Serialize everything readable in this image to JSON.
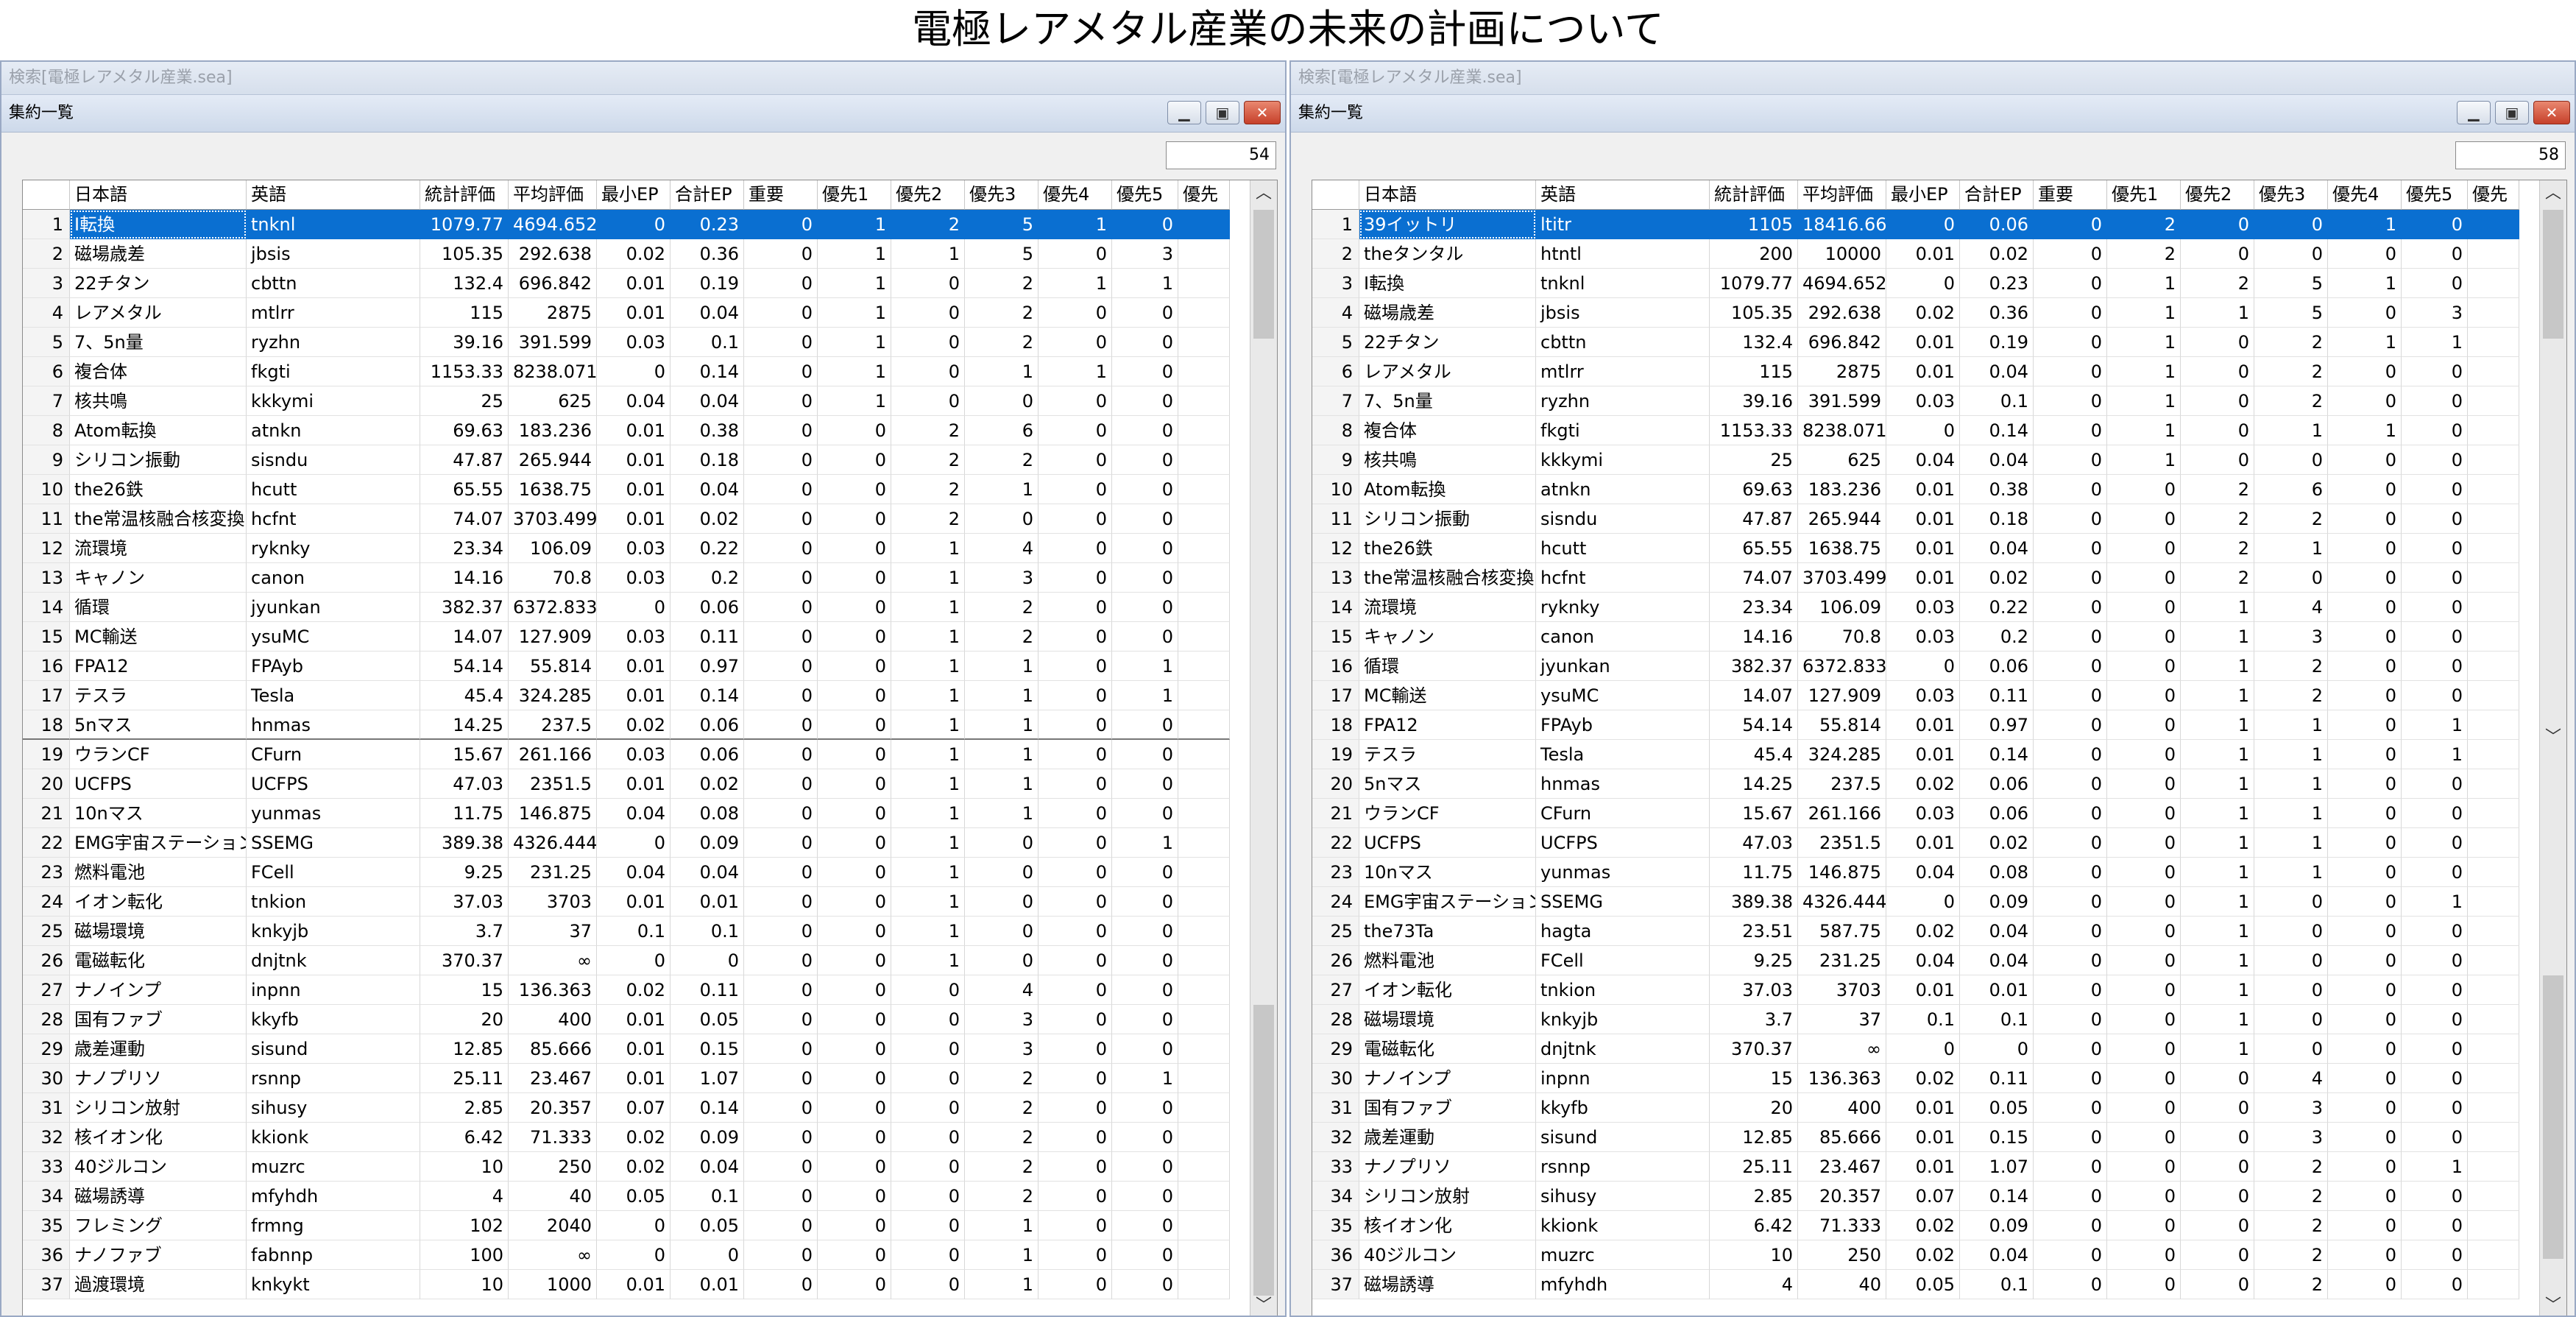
{
  "page_title": "電極レアメタル産業の未来の計画について",
  "icons": {
    "minimize": "minimize-icon",
    "restore": "restore-icon",
    "close": "close-icon",
    "scroll_up": "chevron-up-icon",
    "scroll_down": "chevron-down-icon"
  },
  "columns": [
    "日本語",
    "英語",
    "統計評価",
    "平均評価",
    "最小EP",
    "合計EP",
    "重要",
    "優先1",
    "優先2",
    "優先3",
    "優先4",
    "優先5",
    "優先"
  ],
  "left": {
    "outer_title": "検索[電極レアメタル産業.sea]",
    "inner_title": "集約一覧",
    "count": "54",
    "selected_row": 0,
    "separator_after_row": 17,
    "rows": [
      [
        "1",
        "I転換",
        "tnknl",
        "1079.77",
        "4694.652",
        "0",
        "0.23",
        "0",
        "1",
        "2",
        "5",
        "1",
        "0"
      ],
      [
        "2",
        "磁場歳差",
        "jbsis",
        "105.35",
        "292.638",
        "0.02",
        "0.36",
        "0",
        "1",
        "1",
        "5",
        "0",
        "3"
      ],
      [
        "3",
        "22チタン",
        "cbttn",
        "132.4",
        "696.842",
        "0.01",
        "0.19",
        "0",
        "1",
        "0",
        "2",
        "1",
        "1"
      ],
      [
        "4",
        "レアメタル",
        "mtlrr",
        "115",
        "2875",
        "0.01",
        "0.04",
        "0",
        "1",
        "0",
        "2",
        "0",
        "0"
      ],
      [
        "5",
        "7、5n量",
        "ryzhn",
        "39.16",
        "391.599",
        "0.03",
        "0.1",
        "0",
        "1",
        "0",
        "2",
        "0",
        "0"
      ],
      [
        "6",
        "複合体",
        "fkgti",
        "1153.33",
        "8238.071",
        "0",
        "0.14",
        "0",
        "1",
        "0",
        "1",
        "1",
        "0"
      ],
      [
        "7",
        "核共鳴",
        "kkkymi",
        "25",
        "625",
        "0.04",
        "0.04",
        "0",
        "1",
        "0",
        "0",
        "0",
        "0"
      ],
      [
        "8",
        "Atom転換",
        "atnkn",
        "69.63",
        "183.236",
        "0.01",
        "0.38",
        "0",
        "0",
        "2",
        "6",
        "0",
        "0"
      ],
      [
        "9",
        "シリコン振動",
        "sisndu",
        "47.87",
        "265.944",
        "0.01",
        "0.18",
        "0",
        "0",
        "2",
        "2",
        "0",
        "0"
      ],
      [
        "10",
        "the26鉄",
        "hcutt",
        "65.55",
        "1638.75",
        "0.01",
        "0.04",
        "0",
        "0",
        "2",
        "1",
        "0",
        "0"
      ],
      [
        "11",
        "the常温核融合核変換",
        "hcfnt",
        "74.07",
        "3703.499",
        "0.01",
        "0.02",
        "0",
        "0",
        "2",
        "0",
        "0",
        "0"
      ],
      [
        "12",
        "流環境",
        "ryknky",
        "23.34",
        "106.09",
        "0.03",
        "0.22",
        "0",
        "0",
        "1",
        "4",
        "0",
        "0"
      ],
      [
        "13",
        "キャノン",
        "canon",
        "14.16",
        "70.8",
        "0.03",
        "0.2",
        "0",
        "0",
        "1",
        "3",
        "0",
        "0"
      ],
      [
        "14",
        "循環",
        "jyunkan",
        "382.37",
        "6372.833",
        "0",
        "0.06",
        "0",
        "0",
        "1",
        "2",
        "0",
        "0"
      ],
      [
        "15",
        "MC輸送",
        "ysuMC",
        "14.07",
        "127.909",
        "0.03",
        "0.11",
        "0",
        "0",
        "1",
        "2",
        "0",
        "0"
      ],
      [
        "16",
        "FPA12",
        "FPAyb",
        "54.14",
        "55.814",
        "0.01",
        "0.97",
        "0",
        "0",
        "1",
        "1",
        "0",
        "1"
      ],
      [
        "17",
        "テスラ",
        "Tesla",
        "45.4",
        "324.285",
        "0.01",
        "0.14",
        "0",
        "0",
        "1",
        "1",
        "0",
        "1"
      ],
      [
        "18",
        "5nマス",
        "hnmas",
        "14.25",
        "237.5",
        "0.02",
        "0.06",
        "0",
        "0",
        "1",
        "1",
        "0",
        "0"
      ],
      [
        "19",
        "ウランCF",
        "CFurn",
        "15.67",
        "261.166",
        "0.03",
        "0.06",
        "0",
        "0",
        "1",
        "1",
        "0",
        "0"
      ],
      [
        "20",
        "UCFPS",
        "UCFPS",
        "47.03",
        "2351.5",
        "0.01",
        "0.02",
        "0",
        "0",
        "1",
        "1",
        "0",
        "0"
      ],
      [
        "21",
        "10nマス",
        "yunmas",
        "11.75",
        "146.875",
        "0.04",
        "0.08",
        "0",
        "0",
        "1",
        "1",
        "0",
        "0"
      ],
      [
        "22",
        "EMG宇宙ステーション",
        "SSEMG",
        "389.38",
        "4326.444",
        "0",
        "0.09",
        "0",
        "0",
        "1",
        "0",
        "0",
        "1"
      ],
      [
        "23",
        "燃料電池",
        "FCell",
        "9.25",
        "231.25",
        "0.04",
        "0.04",
        "0",
        "0",
        "1",
        "0",
        "0",
        "0"
      ],
      [
        "24",
        "イオン転化",
        "tnkion",
        "37.03",
        "3703",
        "0.01",
        "0.01",
        "0",
        "0",
        "1",
        "0",
        "0",
        "0"
      ],
      [
        "25",
        "磁場環境",
        "knkyjb",
        "3.7",
        "37",
        "0.1",
        "0.1",
        "0",
        "0",
        "1",
        "0",
        "0",
        "0"
      ],
      [
        "26",
        "電磁転化",
        "dnjtnk",
        "370.37",
        "∞",
        "0",
        "0",
        "0",
        "0",
        "1",
        "0",
        "0",
        "0"
      ],
      [
        "27",
        "ナノインプ",
        "inpnn",
        "15",
        "136.363",
        "0.02",
        "0.11",
        "0",
        "0",
        "0",
        "4",
        "0",
        "0"
      ],
      [
        "28",
        "国有ファブ",
        "kkyfb",
        "20",
        "400",
        "0.01",
        "0.05",
        "0",
        "0",
        "0",
        "3",
        "0",
        "0"
      ],
      [
        "29",
        "歳差運動",
        "sisund",
        "12.85",
        "85.666",
        "0.01",
        "0.15",
        "0",
        "0",
        "0",
        "3",
        "0",
        "0"
      ],
      [
        "30",
        "ナノプリソ",
        "rsnnp",
        "25.11",
        "23.467",
        "0.01",
        "1.07",
        "0",
        "0",
        "0",
        "2",
        "0",
        "1"
      ],
      [
        "31",
        "シリコン放射",
        "sihusy",
        "2.85",
        "20.357",
        "0.07",
        "0.14",
        "0",
        "0",
        "0",
        "2",
        "0",
        "0"
      ],
      [
        "32",
        "核イオン化",
        "kkionk",
        "6.42",
        "71.333",
        "0.02",
        "0.09",
        "0",
        "0",
        "0",
        "2",
        "0",
        "0"
      ],
      [
        "33",
        "40ジルコン",
        "muzrc",
        "10",
        "250",
        "0.02",
        "0.04",
        "0",
        "0",
        "0",
        "2",
        "0",
        "0"
      ],
      [
        "34",
        "磁場誘導",
        "mfyhdh",
        "4",
        "40",
        "0.05",
        "0.1",
        "0",
        "0",
        "0",
        "2",
        "0",
        "0"
      ],
      [
        "35",
        "フレミング",
        "frmng",
        "102",
        "2040",
        "0",
        "0.05",
        "0",
        "0",
        "0",
        "1",
        "0",
        "0"
      ],
      [
        "36",
        "ナノファブ",
        "fabnnp",
        "100",
        "∞",
        "0",
        "0",
        "0",
        "0",
        "0",
        "1",
        "0",
        "0"
      ],
      [
        "37",
        "過渡環境",
        "knkykt",
        "10",
        "1000",
        "0.01",
        "0.01",
        "0",
        "0",
        "0",
        "1",
        "0",
        "0"
      ]
    ]
  },
  "right": {
    "outer_title": "検索[電極レアメタル産業.sea]",
    "inner_title": "集約一覧",
    "count": "58",
    "selected_row": 0,
    "rows": [
      [
        "1",
        "39イットリ",
        "ltitr",
        "1105",
        "18416.666",
        "0",
        "0.06",
        "0",
        "2",
        "0",
        "0",
        "1",
        "0"
      ],
      [
        "2",
        "theタンタル",
        "htntl",
        "200",
        "10000",
        "0.01",
        "0.02",
        "0",
        "2",
        "0",
        "0",
        "0",
        "0"
      ],
      [
        "3",
        "I転換",
        "tnknl",
        "1079.77",
        "4694.652",
        "0",
        "0.23",
        "0",
        "1",
        "2",
        "5",
        "1",
        "0"
      ],
      [
        "4",
        "磁場歳差",
        "jbsis",
        "105.35",
        "292.638",
        "0.02",
        "0.36",
        "0",
        "1",
        "1",
        "5",
        "0",
        "3"
      ],
      [
        "5",
        "22チタン",
        "cbttn",
        "132.4",
        "696.842",
        "0.01",
        "0.19",
        "0",
        "1",
        "0",
        "2",
        "1",
        "1"
      ],
      [
        "6",
        "レアメタル",
        "mtlrr",
        "115",
        "2875",
        "0.01",
        "0.04",
        "0",
        "1",
        "0",
        "2",
        "0",
        "0"
      ],
      [
        "7",
        "7、5n量",
        "ryzhn",
        "39.16",
        "391.599",
        "0.03",
        "0.1",
        "0",
        "1",
        "0",
        "2",
        "0",
        "0"
      ],
      [
        "8",
        "複合体",
        "fkgti",
        "1153.33",
        "8238.071",
        "0",
        "0.14",
        "0",
        "1",
        "0",
        "1",
        "1",
        "0"
      ],
      [
        "9",
        "核共鳴",
        "kkkymi",
        "25",
        "625",
        "0.04",
        "0.04",
        "0",
        "1",
        "0",
        "0",
        "0",
        "0"
      ],
      [
        "10",
        "Atom転換",
        "atnkn",
        "69.63",
        "183.236",
        "0.01",
        "0.38",
        "0",
        "0",
        "2",
        "6",
        "0",
        "0"
      ],
      [
        "11",
        "シリコン振動",
        "sisndu",
        "47.87",
        "265.944",
        "0.01",
        "0.18",
        "0",
        "0",
        "2",
        "2",
        "0",
        "0"
      ],
      [
        "12",
        "the26鉄",
        "hcutt",
        "65.55",
        "1638.75",
        "0.01",
        "0.04",
        "0",
        "0",
        "2",
        "1",
        "0",
        "0"
      ],
      [
        "13",
        "the常温核融合核変換",
        "hcfnt",
        "74.07",
        "3703.499",
        "0.01",
        "0.02",
        "0",
        "0",
        "2",
        "0",
        "0",
        "0"
      ],
      [
        "14",
        "流環境",
        "ryknky",
        "23.34",
        "106.09",
        "0.03",
        "0.22",
        "0",
        "0",
        "1",
        "4",
        "0",
        "0"
      ],
      [
        "15",
        "キャノン",
        "canon",
        "14.16",
        "70.8",
        "0.03",
        "0.2",
        "0",
        "0",
        "1",
        "3",
        "0",
        "0"
      ],
      [
        "16",
        "循環",
        "jyunkan",
        "382.37",
        "6372.833",
        "0",
        "0.06",
        "0",
        "0",
        "1",
        "2",
        "0",
        "0"
      ],
      [
        "17",
        "MC輸送",
        "ysuMC",
        "14.07",
        "127.909",
        "0.03",
        "0.11",
        "0",
        "0",
        "1",
        "2",
        "0",
        "0"
      ],
      [
        "18",
        "FPA12",
        "FPAyb",
        "54.14",
        "55.814",
        "0.01",
        "0.97",
        "0",
        "0",
        "1",
        "1",
        "0",
        "1"
      ],
      [
        "19",
        "テスラ",
        "Tesla",
        "45.4",
        "324.285",
        "0.01",
        "0.14",
        "0",
        "0",
        "1",
        "1",
        "0",
        "1"
      ],
      [
        "20",
        "5nマス",
        "hnmas",
        "14.25",
        "237.5",
        "0.02",
        "0.06",
        "0",
        "0",
        "1",
        "1",
        "0",
        "0"
      ],
      [
        "21",
        "ウランCF",
        "CFurn",
        "15.67",
        "261.166",
        "0.03",
        "0.06",
        "0",
        "0",
        "1",
        "1",
        "0",
        "0"
      ],
      [
        "22",
        "UCFPS",
        "UCFPS",
        "47.03",
        "2351.5",
        "0.01",
        "0.02",
        "0",
        "0",
        "1",
        "1",
        "0",
        "0"
      ],
      [
        "23",
        "10nマス",
        "yunmas",
        "11.75",
        "146.875",
        "0.04",
        "0.08",
        "0",
        "0",
        "1",
        "1",
        "0",
        "0"
      ],
      [
        "24",
        "EMG宇宙ステーション",
        "SSEMG",
        "389.38",
        "4326.444",
        "0",
        "0.09",
        "0",
        "0",
        "1",
        "0",
        "0",
        "1"
      ],
      [
        "25",
        "the73Ta",
        "hagta",
        "23.51",
        "587.75",
        "0.02",
        "0.04",
        "0",
        "0",
        "1",
        "0",
        "0",
        "0"
      ],
      [
        "26",
        "燃料電池",
        "FCell",
        "9.25",
        "231.25",
        "0.04",
        "0.04",
        "0",
        "0",
        "1",
        "0",
        "0",
        "0"
      ],
      [
        "27",
        "イオン転化",
        "tnkion",
        "37.03",
        "3703",
        "0.01",
        "0.01",
        "0",
        "0",
        "1",
        "0",
        "0",
        "0"
      ],
      [
        "28",
        "磁場環境",
        "knkyjb",
        "3.7",
        "37",
        "0.1",
        "0.1",
        "0",
        "0",
        "1",
        "0",
        "0",
        "0"
      ],
      [
        "29",
        "電磁転化",
        "dnjtnk",
        "370.37",
        "∞",
        "0",
        "0",
        "0",
        "0",
        "1",
        "0",
        "0",
        "0"
      ],
      [
        "30",
        "ナノインプ",
        "inpnn",
        "15",
        "136.363",
        "0.02",
        "0.11",
        "0",
        "0",
        "0",
        "4",
        "0",
        "0"
      ],
      [
        "31",
        "国有ファブ",
        "kkyfb",
        "20",
        "400",
        "0.01",
        "0.05",
        "0",
        "0",
        "0",
        "3",
        "0",
        "0"
      ],
      [
        "32",
        "歳差運動",
        "sisund",
        "12.85",
        "85.666",
        "0.01",
        "0.15",
        "0",
        "0",
        "0",
        "3",
        "0",
        "0"
      ],
      [
        "33",
        "ナノプリソ",
        "rsnnp",
        "25.11",
        "23.467",
        "0.01",
        "1.07",
        "0",
        "0",
        "0",
        "2",
        "0",
        "1"
      ],
      [
        "34",
        "シリコン放射",
        "sihusy",
        "2.85",
        "20.357",
        "0.07",
        "0.14",
        "0",
        "0",
        "0",
        "2",
        "0",
        "0"
      ],
      [
        "35",
        "核イオン化",
        "kkionk",
        "6.42",
        "71.333",
        "0.02",
        "0.09",
        "0",
        "0",
        "0",
        "2",
        "0",
        "0"
      ],
      [
        "36",
        "40ジルコン",
        "muzrc",
        "10",
        "250",
        "0.02",
        "0.04",
        "0",
        "0",
        "0",
        "2",
        "0",
        "0"
      ],
      [
        "37",
        "磁場誘導",
        "mfyhdh",
        "4",
        "40",
        "0.05",
        "0.1",
        "0",
        "0",
        "0",
        "2",
        "0",
        "0"
      ]
    ]
  }
}
